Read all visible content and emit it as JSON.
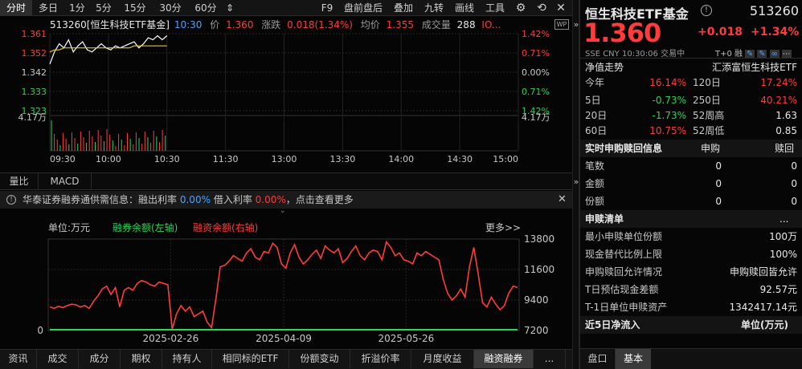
{
  "top_tabs": [
    "分时",
    "多日",
    "1分",
    "5分",
    "15分",
    "30分",
    "60分",
    "⇕"
  ],
  "tools": [
    "F9",
    "盘前盘后",
    "叠加",
    "九转",
    "画线",
    "工具"
  ],
  "chart_header": {
    "code_name": "513260[恒生科技ETF基金]",
    "time": "10:30",
    "price_label": "价",
    "price": "1.360",
    "change_label": "涨跌",
    "change": "0.018(1.34%)",
    "avg_label": "均价",
    "avg": "1.355",
    "vol_label": "成交量",
    "vol": "288",
    "more": "IO..."
  },
  "price_axis": [
    "1.361",
    "1.352",
    "1.342",
    "1.333",
    "1.323"
  ],
  "pct_axis": [
    "1.42%",
    "0.71%",
    "0.00%",
    "0.71%",
    "1.42%"
  ],
  "vol_axis": "4.17万",
  "time_axis": [
    "09:30",
    "10:00",
    "10:30",
    "11:30",
    "13:00",
    "13:30",
    "14:00",
    "14:30",
    "15:00"
  ],
  "indicator_tabs": [
    "量比",
    "MACD"
  ],
  "notice": {
    "prefix": "华泰证券融券通供需信息：",
    "rate1_label": "融出利率",
    "rate1": "0.00%",
    "rate2_label": "借入利率",
    "rate2": "0.00%",
    "tail": "，点击查看更多"
  },
  "margin_panel": {
    "unit": "单位:万元",
    "legend_short": "融券余额(左轴)",
    "legend_long": "融资余额(右轴)",
    "more": "更多>>",
    "left_axis": [
      "0"
    ],
    "right_axis": [
      "13800",
      "11600",
      "9400",
      "7200"
    ],
    "dates": [
      "2025-02-26",
      "2025-04-09",
      "2025-05-26"
    ]
  },
  "bottom_tabs": [
    "资讯",
    "成交",
    "成分",
    "期权",
    "持有人",
    "相同标的ETF",
    "份额变动",
    "折溢价率",
    "月度收益",
    "融资融券",
    "..."
  ],
  "quote": {
    "name": "恒生科技ETF基金",
    "code": "513260",
    "price": "1.360",
    "change": "+0.018",
    "change_pct": "+1.34%",
    "exchange": "SSE",
    "currency": "CNY",
    "time": "10:30:06",
    "status": "交易中",
    "nav_label": "净值走势",
    "manager": "汇添富恒生科技ETF"
  },
  "perf": [
    {
      "l1": "今年",
      "v1": "16.14%",
      "c1": "red",
      "l2": "120日",
      "v2": "17.24%",
      "c2": "red"
    },
    {
      "l1": "5日",
      "v1": "-0.73%",
      "c1": "green",
      "l2": "250日",
      "v2": "40.21%",
      "c2": "red"
    },
    {
      "l1": "20日",
      "v1": "-1.73%",
      "c1": "green",
      "l2": "52周高",
      "v2": "1.63",
      "c2": "white"
    },
    {
      "l1": "60日",
      "v1": "10.75%",
      "c1": "red",
      "l2": "52周低",
      "v2": "0.85",
      "c2": "white"
    }
  ],
  "realtime": {
    "title": "实时申购赎回信息",
    "col1": "申购",
    "col2": "赎回",
    "rows": [
      {
        "label": "笔数",
        "a": "0",
        "b": "0"
      },
      {
        "label": "金额",
        "a": "0",
        "b": "0"
      },
      {
        "label": "份额",
        "a": "0",
        "b": "0"
      }
    ]
  },
  "list": {
    "title": "申赎清单",
    "dots": "...",
    "rows": [
      {
        "label": "最小申赎单位份额",
        "value": "100万"
      },
      {
        "label": "现金替代比例上限",
        "value": "100%"
      },
      {
        "label": "申购赎回允许情况",
        "value": "申购赎回皆允许"
      },
      {
        "label": "T日预估现金差额",
        "value": "92.57元"
      },
      {
        "label": "T-1日单位申赎资产",
        "value": "1342417.14元"
      }
    ]
  },
  "flow": {
    "title": "近5日净流入",
    "unit": "单位(万元)"
  },
  "right_tabs": [
    "盘口",
    "基本"
  ],
  "chart_data": [
    {
      "type": "line",
      "title": "513260[恒生科技ETF基金]",
      "x_range": [
        "09:30",
        "15:00"
      ],
      "ylim": [
        1.323,
        1.361
      ],
      "series": [
        {
          "name": "价",
          "values": [
            1.346,
            1.352,
            1.356,
            1.354,
            1.358,
            1.352,
            1.355,
            1.357,
            1.353,
            1.352,
            1.354,
            1.356,
            1.354,
            1.353,
            1.355,
            1.354,
            1.355,
            1.356,
            1.357,
            1.354,
            1.356,
            1.359,
            1.358,
            1.36,
            1.358,
            1.36
          ]
        },
        {
          "name": "均价",
          "values": [
            1.352,
            1.353,
            1.353,
            1.354,
            1.354,
            1.354,
            1.354,
            1.354,
            1.354,
            1.354,
            1.354,
            1.354,
            1.354,
            1.354,
            1.354,
            1.354,
            1.354,
            1.354,
            1.355,
            1.355,
            1.355,
            1.355,
            1.355,
            1.355,
            1.355,
            1.355
          ]
        }
      ]
    },
    {
      "type": "line",
      "x_labels": [
        "2025-02-26",
        "2025-04-09",
        "2025-05-26"
      ],
      "y_right_range": [
        7200,
        13800
      ],
      "series": [
        {
          "name": "融资余额(右轴)",
          "values": [
            8900,
            8800,
            8950,
            8850,
            9000,
            9100,
            9050,
            8900,
            9000,
            8800,
            9300,
            9700,
            10200,
            10400,
            9800,
            10300,
            8900,
            10100,
            10300,
            10100,
            10600,
            10800,
            10700,
            10500,
            10400,
            10700,
            10600,
            10500,
            7300,
            8400,
            9000,
            8600,
            8900,
            8200,
            8400,
            8600,
            7800,
            7400,
            9500,
            11800,
            11900,
            12200,
            12600,
            12400,
            12200,
            12800,
            13100,
            12500,
            12300,
            12900,
            12800,
            13500,
            13200,
            12000,
            11700,
            12800,
            13400,
            12500,
            12000,
            12300,
            12700,
            13000,
            12400,
            13300,
            13000,
            12800,
            13100,
            12100,
            12400,
            12900,
            13300,
            12600,
            12300,
            12800,
            13000,
            12900,
            12300,
            13600,
            13200,
            12600,
            12800,
            12300,
            12200,
            12000,
            12800,
            12600,
            12900,
            12700,
            12500,
            12300,
            10900,
            9900,
            9400,
            9700,
            10200,
            9600,
            11800,
            13200,
            11300,
            9200,
            8900,
            9600,
            9100,
            8700,
            9000,
            9900,
            10400,
            10300
          ]
        },
        {
          "name": "融券余额(左轴)",
          "values": [
            0,
            0,
            0,
            0,
            0,
            0,
            0,
            0,
            0,
            0
          ]
        }
      ]
    }
  ]
}
